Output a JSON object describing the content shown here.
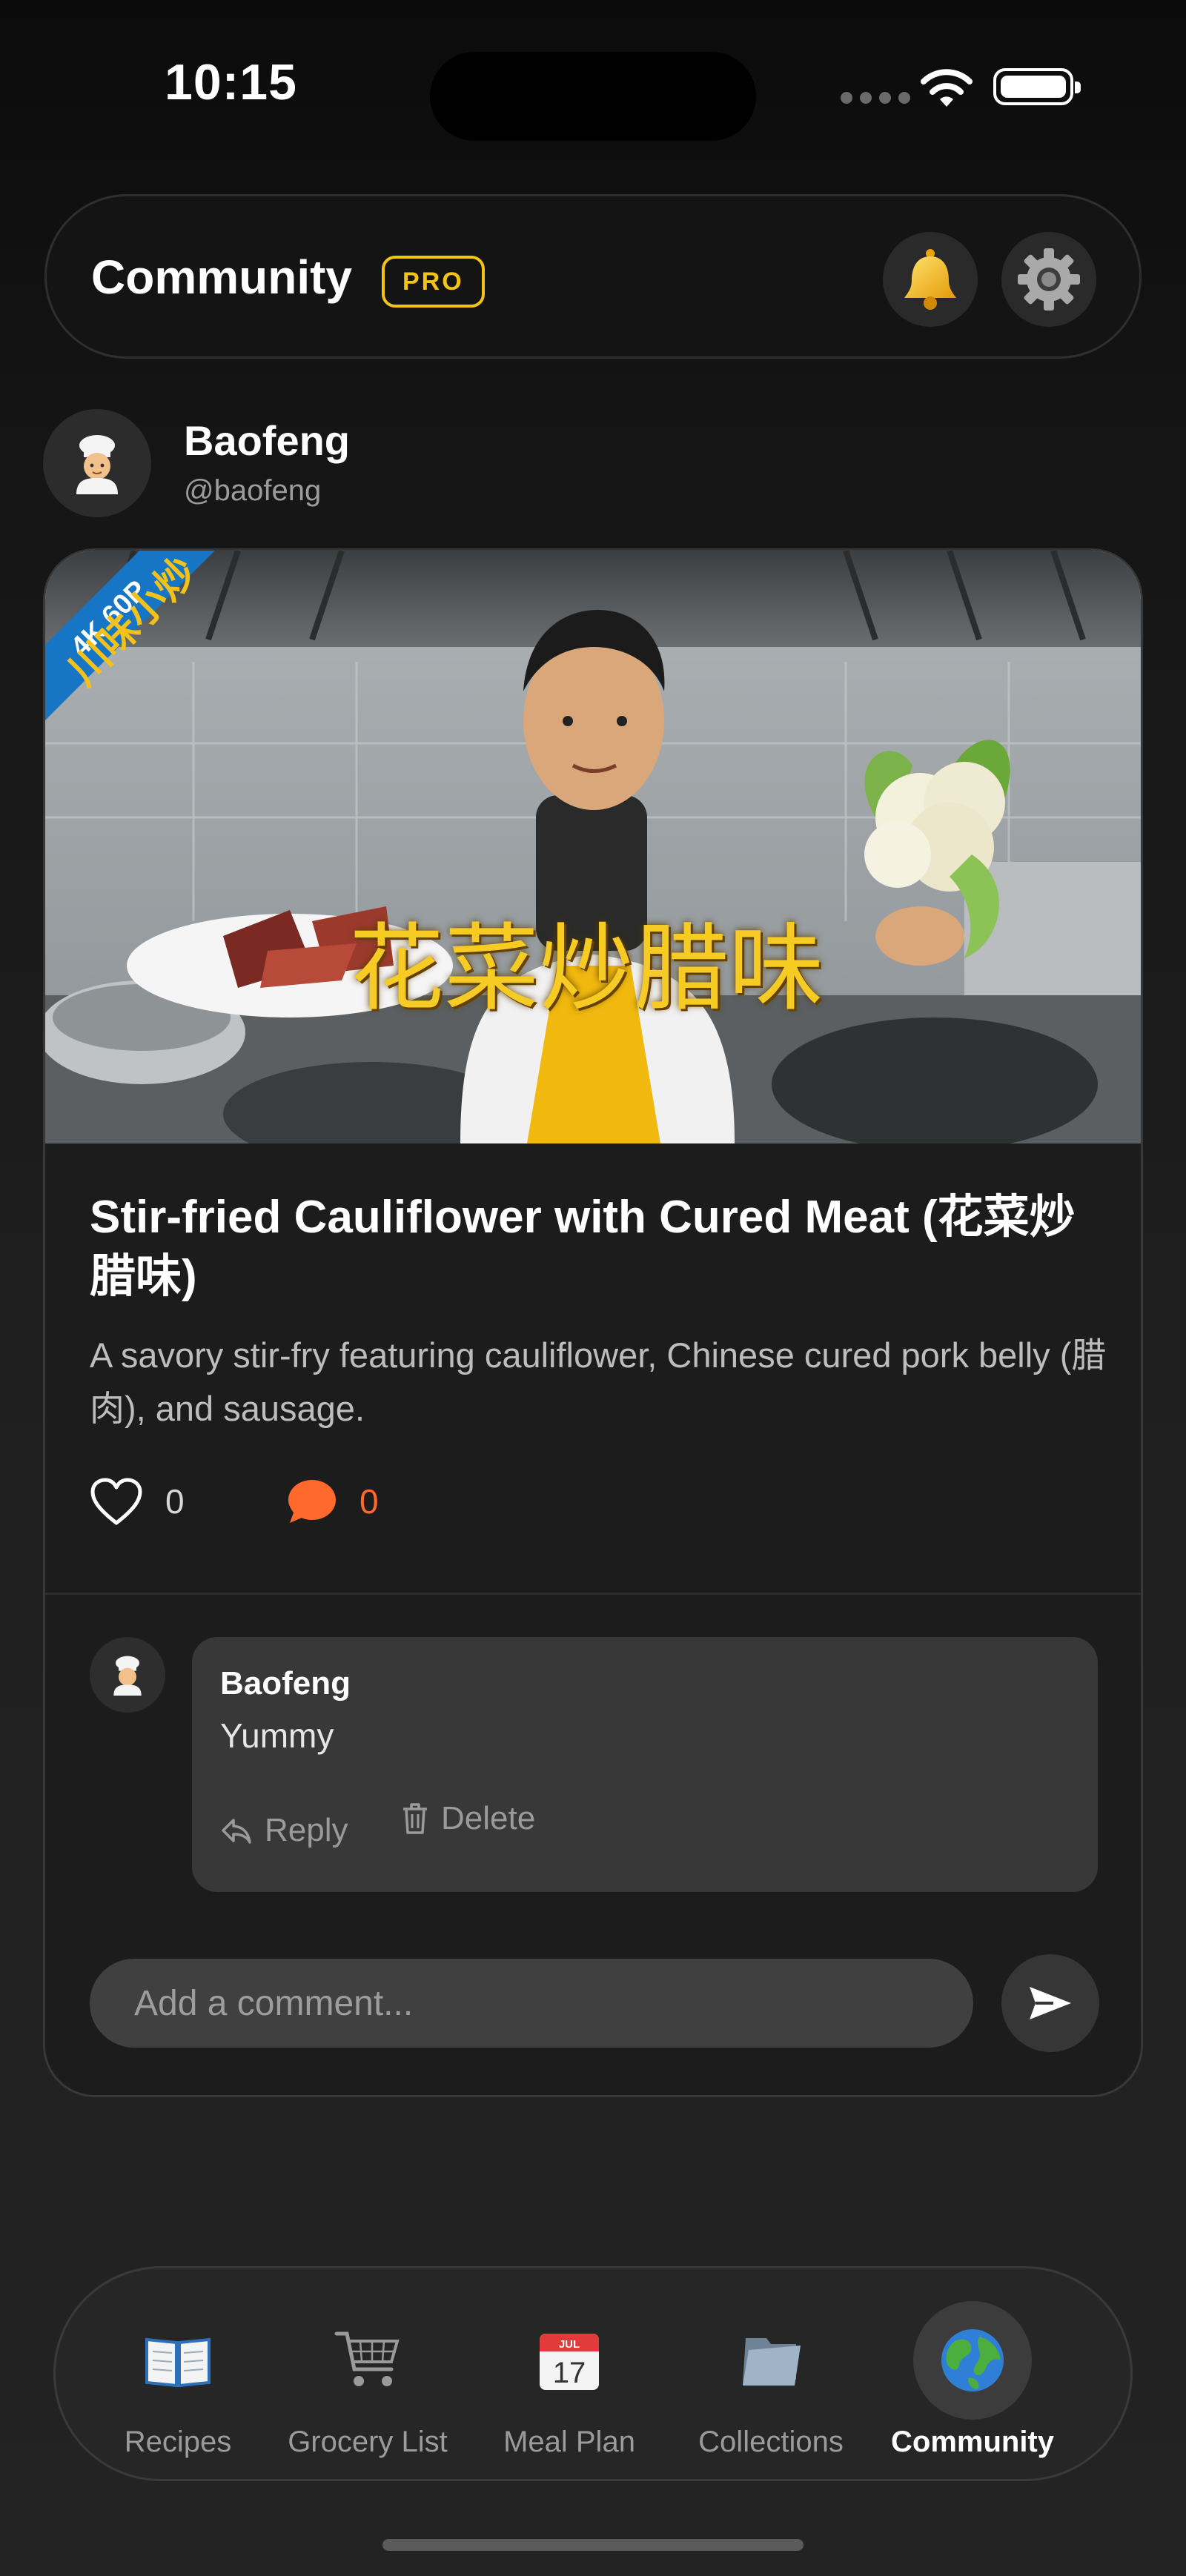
{
  "status_bar": {
    "time": "10:15"
  },
  "header": {
    "title": "Community",
    "badge": "PRO",
    "icons": [
      "bell-icon",
      "gear-icon"
    ]
  },
  "post": {
    "author": {
      "name": "Baofeng",
      "handle": "@baofeng",
      "avatar": "chef-emoji"
    },
    "image": {
      "overlay_text": "花菜炒腊味",
      "corner_banner": "4K 60P",
      "corner_text": "川味小炒"
    },
    "title": "Stir-fried Cauliflower with Cured Meat (花菜炒腊味)",
    "description": "A savory stir-fry featuring cauliflower, Chinese cured pork belly (腊肉), and sausage.",
    "likes": "0",
    "comments_count": "0",
    "comments": [
      {
        "author": "Baofeng",
        "text": "Yummy",
        "reply_label": "Reply",
        "delete_label": "Delete"
      }
    ],
    "comment_input": {
      "placeholder": "Add a comment..."
    }
  },
  "tabbar": {
    "tabs": [
      {
        "label": "Recipes",
        "icon": "book-icon"
      },
      {
        "label": "Grocery List",
        "icon": "cart-icon"
      },
      {
        "label": "Meal Plan",
        "icon": "calendar-icon"
      },
      {
        "label": "Collections",
        "icon": "folder-icon"
      },
      {
        "label": "Community",
        "icon": "globe-icon",
        "active": true
      }
    ],
    "calendar_month": "JUL",
    "calendar_day": "17"
  },
  "colors": {
    "accent": "#f3c316",
    "comment_accent": "#ff6a2c",
    "background": "#1c1c1c"
  }
}
